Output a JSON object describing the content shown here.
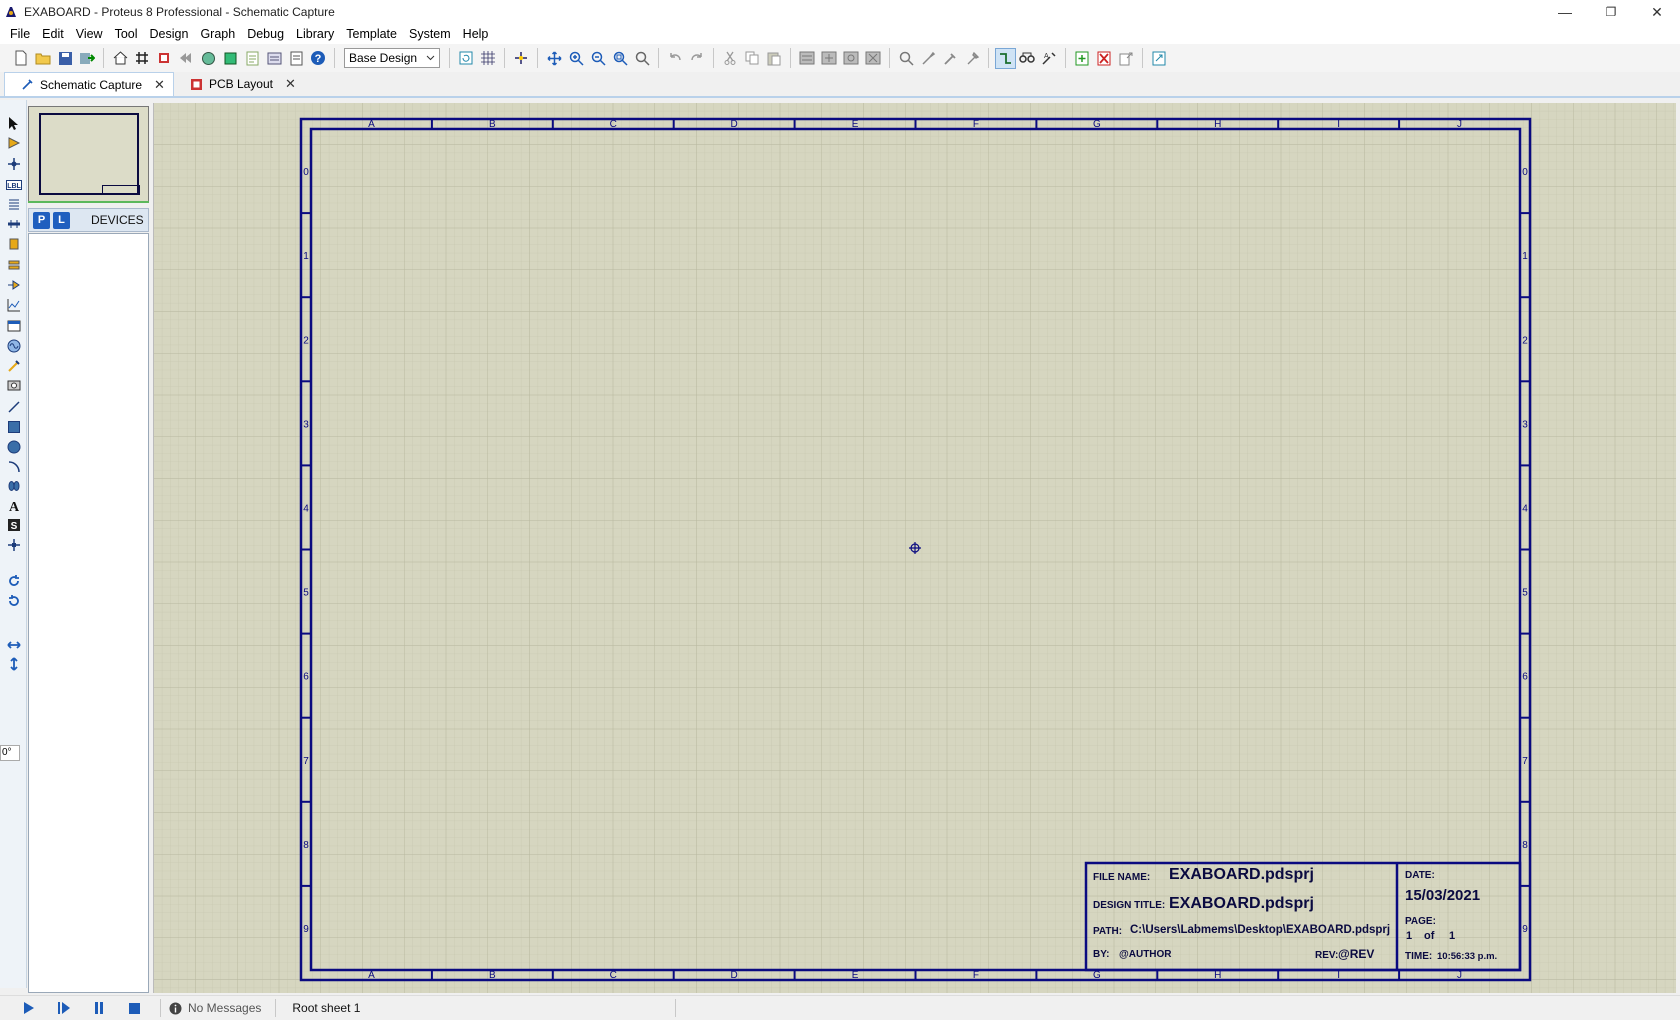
{
  "window": {
    "title": "EXABOARD - Proteus 8 Professional - Schematic Capture",
    "minimize": "—",
    "restore": "❐",
    "close": "✕"
  },
  "menu": [
    "File",
    "Edit",
    "View",
    "Tool",
    "Design",
    "Graph",
    "Debug",
    "Library",
    "Template",
    "System",
    "Help"
  ],
  "toolbar": {
    "variant_select": "Base Design"
  },
  "tabs": [
    {
      "label": "Schematic Capture",
      "active": true
    },
    {
      "label": "PCB Layout",
      "active": false
    }
  ],
  "left_panel": {
    "rotation_value": "0°",
    "p_button": "P",
    "l_button": "L",
    "devices_label": "DEVICES"
  },
  "sheet": {
    "columns": [
      "A",
      "B",
      "C",
      "D",
      "E",
      "F",
      "G",
      "H",
      "I",
      "J"
    ],
    "rows": [
      "0",
      "1",
      "2",
      "3",
      "4",
      "5",
      "6",
      "7",
      "8",
      "9"
    ],
    "title_block": {
      "file_name_label": "FILE NAME:",
      "file_name": "EXABOARD.pdsprj",
      "design_title_label": "DESIGN TITLE:",
      "design_title": "EXABOARD.pdsprj",
      "path_label": "PATH:",
      "path": "C:\\Users\\Labmems\\Desktop\\EXABOARD.pdsprj",
      "by_label": "BY:",
      "by": "@AUTHOR",
      "rev_label": "REV:",
      "rev": "@REV",
      "date_label": "DATE:",
      "date": "15/03/2021",
      "page_label": "PAGE:",
      "page": "1",
      "page_of": "of",
      "page_total": "1",
      "time_label": "TIME:",
      "time": "10:56:33 p.m."
    }
  },
  "status": {
    "messages": "No Messages",
    "sheet": "Root sheet 1"
  },
  "colors": {
    "canvas": "#d6d6c0",
    "sheet_border": "#0a0a80",
    "grid": "#c4c4ac"
  }
}
